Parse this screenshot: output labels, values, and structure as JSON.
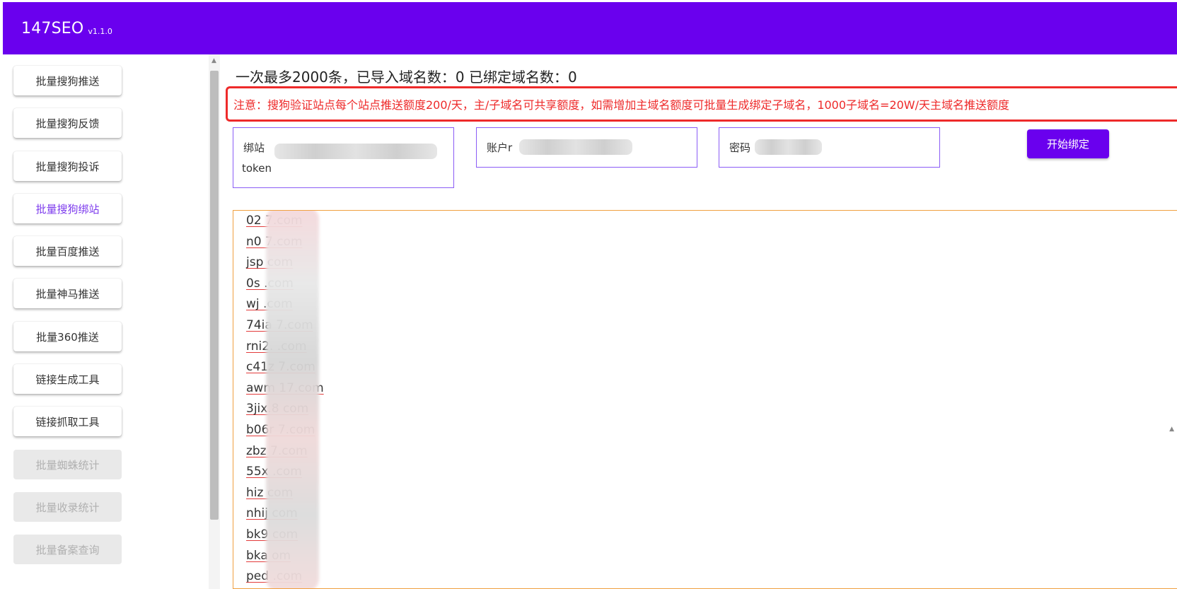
{
  "header": {
    "title": "147SEO",
    "version": "v1.1.0"
  },
  "sidebar": {
    "items": [
      {
        "label": "批量搜狗推送",
        "state": "normal"
      },
      {
        "label": "批量搜狗反馈",
        "state": "normal"
      },
      {
        "label": "批量搜狗投诉",
        "state": "normal"
      },
      {
        "label": "批量搜狗绑站",
        "state": "active"
      },
      {
        "label": "批量百度推送",
        "state": "normal"
      },
      {
        "label": "批量神马推送",
        "state": "normal"
      },
      {
        "label": "批量360推送",
        "state": "normal"
      },
      {
        "label": "链接生成工具",
        "state": "normal"
      },
      {
        "label": "链接抓取工具",
        "state": "normal"
      },
      {
        "label": "批量蜘蛛统计",
        "state": "disabled"
      },
      {
        "label": "批量收录统计",
        "state": "disabled"
      },
      {
        "label": "批量备案查询",
        "state": "disabled"
      }
    ]
  },
  "main": {
    "count_line": "一次最多2000条，已导入域名数：0 已绑定域名数：0",
    "notice": "注意：搜狗验证站点每个站点推送额度200/天，主/子域名可共享额度，如需增加主域名额度可批量生成绑定子域名，1000子域名=20W/天主域名推送额度",
    "fields": {
      "token_label_1": "绑站",
      "token_label_2": "token",
      "account_label": "账户r",
      "password_label": "密码"
    },
    "bind_button": "开始绑定",
    "domains": [
      "02        7.com",
      "n0        7.com",
      "jsp        com",
      "0s        .com",
      "wj        .com",
      "74ia      7.com",
      "rni2.      .com",
      "c41z      7.com",
      "awm      17.com",
      "3jix.8      com",
      "b06r      7.com",
      "zbz       7.com",
      "55x       .com",
      "hiz        com",
      "nhij       com",
      "bk9        com",
      "bka        om",
      "ped       .com"
    ]
  },
  "colors": {
    "brand": "#6a00ee",
    "warning": "#ee2a2a",
    "active": "#7c3aed"
  }
}
